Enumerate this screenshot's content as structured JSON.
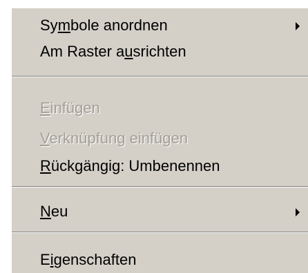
{
  "menu": {
    "items": [
      {
        "pre": "Sy",
        "acc": "m",
        "post": "bole anordnen",
        "enabled": true,
        "submenu": true,
        "icon": "submenu-arrow-icon"
      },
      {
        "pre": "Am Raster a",
        "acc": "u",
        "post": "srichten",
        "enabled": true,
        "submenu": false
      },
      {
        "pre": "",
        "acc": "E",
        "post": "infügen",
        "enabled": false,
        "submenu": false
      },
      {
        "pre": "",
        "acc": "V",
        "post": "erknüpfung einfügen",
        "enabled": false,
        "submenu": false
      },
      {
        "pre": "",
        "acc": "R",
        "post": "ückgängig: Umbenennen",
        "enabled": true,
        "submenu": false
      },
      {
        "pre": "",
        "acc": "N",
        "post": "eu",
        "enabled": true,
        "submenu": true,
        "icon": "submenu-arrow-icon"
      },
      {
        "pre": "E",
        "acc": "i",
        "post": "genschaften",
        "enabled": true,
        "submenu": false
      }
    ]
  },
  "colors": {
    "menu_background": "#d4d0c8",
    "disabled_text": "#a39f96",
    "separator_shadow": "#808080"
  }
}
